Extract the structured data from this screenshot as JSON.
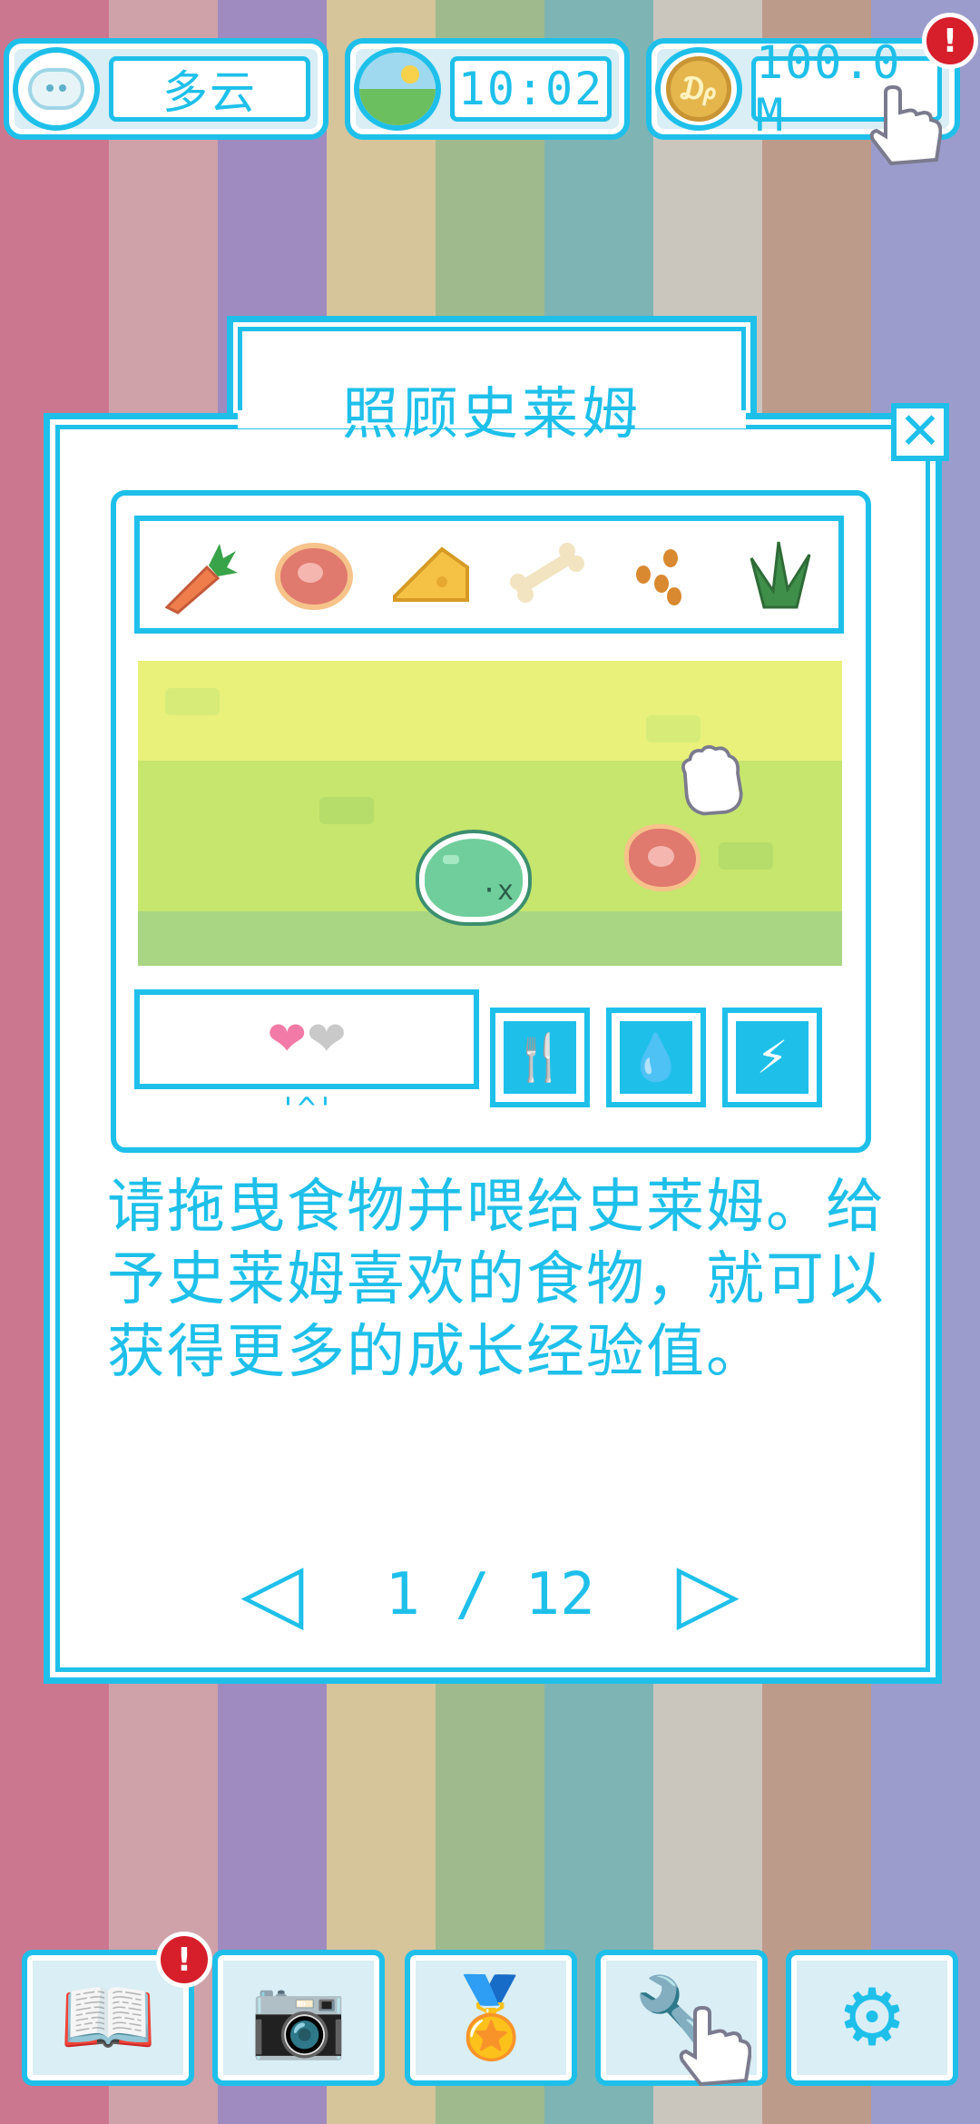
{
  "background_stripes": [
    "#cc7790",
    "#cfa2aa",
    "#9f8bbf",
    "#d6c49b",
    "#9fba8d",
    "#7fb4b4",
    "#cbc6bd",
    "#bd9b8a",
    "#9b9ccc"
  ],
  "status_bar": {
    "weather": {
      "icon": "cloud-face-icon",
      "label": "多云"
    },
    "time": {
      "icon": "landscape-icon",
      "label": "10:02"
    },
    "coins": {
      "icon": "coin-icon",
      "label": "100.0 M"
    },
    "alert_symbol": "!"
  },
  "modal": {
    "title": "照顾史莱姆",
    "close_symbol": "✕",
    "foods": [
      "carrot-icon",
      "steak-icon",
      "cheese-icon",
      "bone-icon",
      "seeds-icon",
      "grass-icon"
    ],
    "hearts": {
      "filled": 1,
      "total": 2,
      "filled_color": "#f27aa6",
      "empty_color": "#c9c9c9"
    },
    "mood_face": "'^'",
    "actions": [
      {
        "name": "feed",
        "icon": "fork-knife-icon",
        "glyph": "🍴"
      },
      {
        "name": "clean",
        "icon": "water-drop-icon",
        "glyph": "💧"
      },
      {
        "name": "play",
        "icon": "lightning-icon",
        "glyph": "⚡"
      }
    ],
    "instructions": "请拖曳食物并喂给史莱姆。给予史莱姆喜欢的食物，就可以获得更多的成长经验值。",
    "pager": {
      "text": "1 / 12",
      "prev": "◁",
      "next": "▷"
    }
  },
  "bottom_nav": [
    {
      "name": "book",
      "icon": "book-icon",
      "glyph": "📖",
      "alert": true
    },
    {
      "name": "camera",
      "icon": "camera-icon",
      "glyph": "📷",
      "alert": false
    },
    {
      "name": "medal",
      "icon": "medal-icon",
      "glyph": "🏅",
      "alert": false
    },
    {
      "name": "tools",
      "icon": "tools-icon",
      "glyph": "🔧",
      "alert": false
    },
    {
      "name": "settings",
      "icon": "gear-icon",
      "glyph": "⚙",
      "alert": false
    }
  ],
  "colors": {
    "accent": "#1ec0ea",
    "alert": "#d61f2b",
    "panel": "#ffffff"
  }
}
